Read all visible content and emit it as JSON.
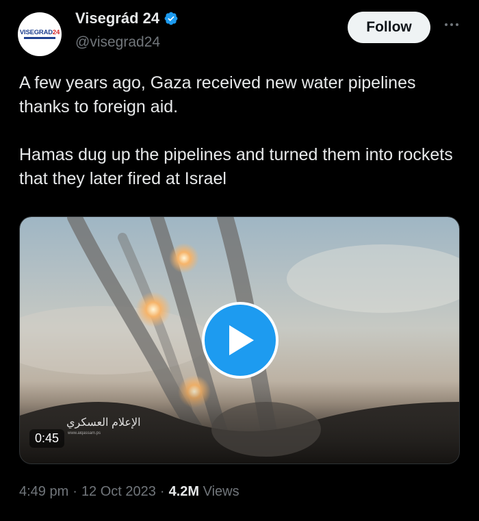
{
  "author": {
    "name": "Visegrád 24",
    "handle": "@visegrad24",
    "avatar_text": "VISEGRAD",
    "avatar_num": "24",
    "verified": true
  },
  "actions": {
    "follow_label": "Follow",
    "more_icon": "more-horizontal-icon"
  },
  "tweet": {
    "paragraphs": [
      "A few years ago, Gaza received new water pipelines thanks to foreign aid.",
      "Hamas dug up the pipelines and turned them into rockets that they later fired at Israel"
    ]
  },
  "media": {
    "duration": "0:45",
    "watermark": "الإعلام العسكري",
    "watermark_sub": "www.alqassam.ps",
    "play_icon": "play-icon"
  },
  "meta": {
    "time": "4:49 pm",
    "date": "12 Oct 2023",
    "views_count": "4.2M",
    "views_label": "Views"
  },
  "colors": {
    "accent": "#1d9bf0",
    "background": "#000000",
    "text": "#e7e9ea",
    "muted": "#71767b"
  }
}
